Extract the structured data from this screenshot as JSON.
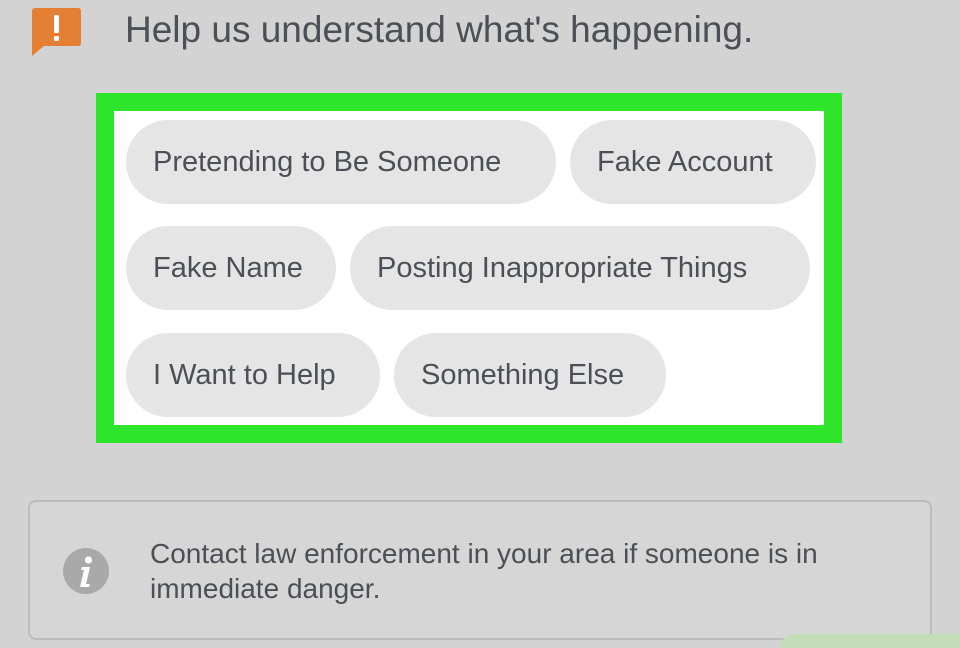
{
  "header": {
    "title": "Help us understand what's happening.",
    "icon": "alert-icon",
    "icon_color": "#e57f34"
  },
  "options": {
    "highlight_color": "#2ee52b",
    "items": [
      {
        "label": "Pretending to Be Someone"
      },
      {
        "label": "Fake Account"
      },
      {
        "label": "Fake Name"
      },
      {
        "label": "Posting Inappropriate Things"
      },
      {
        "label": "I Want to Help"
      },
      {
        "label": "Something Else"
      }
    ]
  },
  "notice": {
    "icon": "info-icon",
    "text": "Contact law enforcement in your area if someone is in immediate danger."
  }
}
